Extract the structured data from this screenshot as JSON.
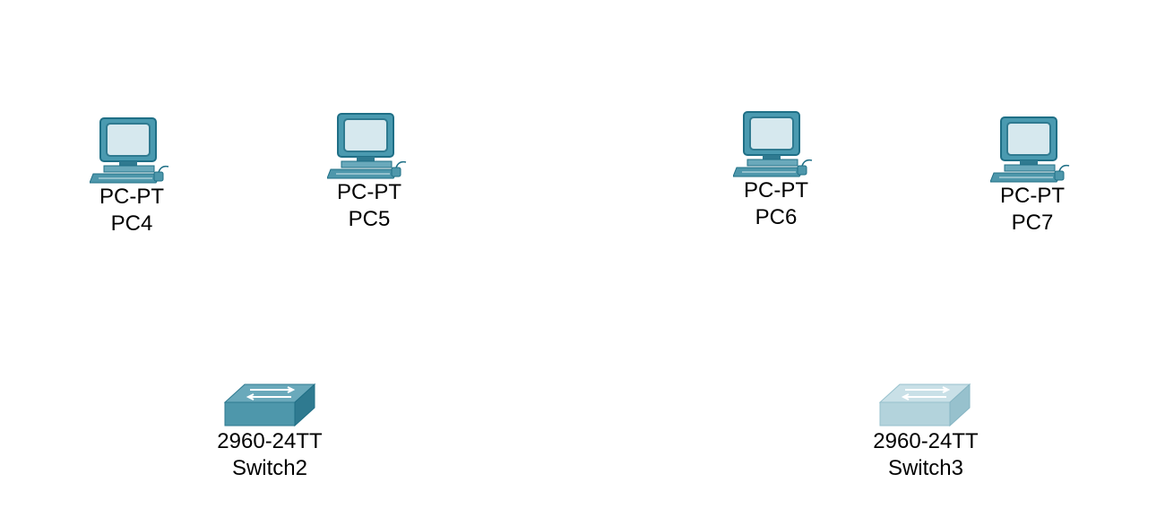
{
  "workspace": {
    "devices": [
      {
        "id": "pc4",
        "kind": "pc",
        "model": "PC-PT",
        "name": "PC4",
        "icon": "pc-icon"
      },
      {
        "id": "pc5",
        "kind": "pc",
        "model": "PC-PT",
        "name": "PC5",
        "icon": "pc-icon"
      },
      {
        "id": "pc6",
        "kind": "pc",
        "model": "PC-PT",
        "name": "PC6",
        "icon": "pc-icon"
      },
      {
        "id": "pc7",
        "kind": "pc",
        "model": "PC-PT",
        "name": "PC7",
        "icon": "pc-icon"
      },
      {
        "id": "switch2",
        "kind": "switch",
        "model": "2960-24TT",
        "name": "Switch2",
        "icon": "switch-icon",
        "style": "normal"
      },
      {
        "id": "switch3",
        "kind": "switch",
        "model": "2960-24TT",
        "name": "Switch3",
        "icon": "switch-icon",
        "style": "faded"
      }
    ]
  },
  "colors": {
    "pc_body": "#4a9ab0",
    "pc_dark": "#1f6f86",
    "pc_screen": "#d6e8ee",
    "switch_top": "#6aa9bb",
    "switch_front": "#4e97ab",
    "switch_side": "#2f7a90",
    "switch_faded_top": "#c9e0e7",
    "switch_faded_front": "#b3d3dc",
    "switch_faded_side": "#97c1cd"
  }
}
